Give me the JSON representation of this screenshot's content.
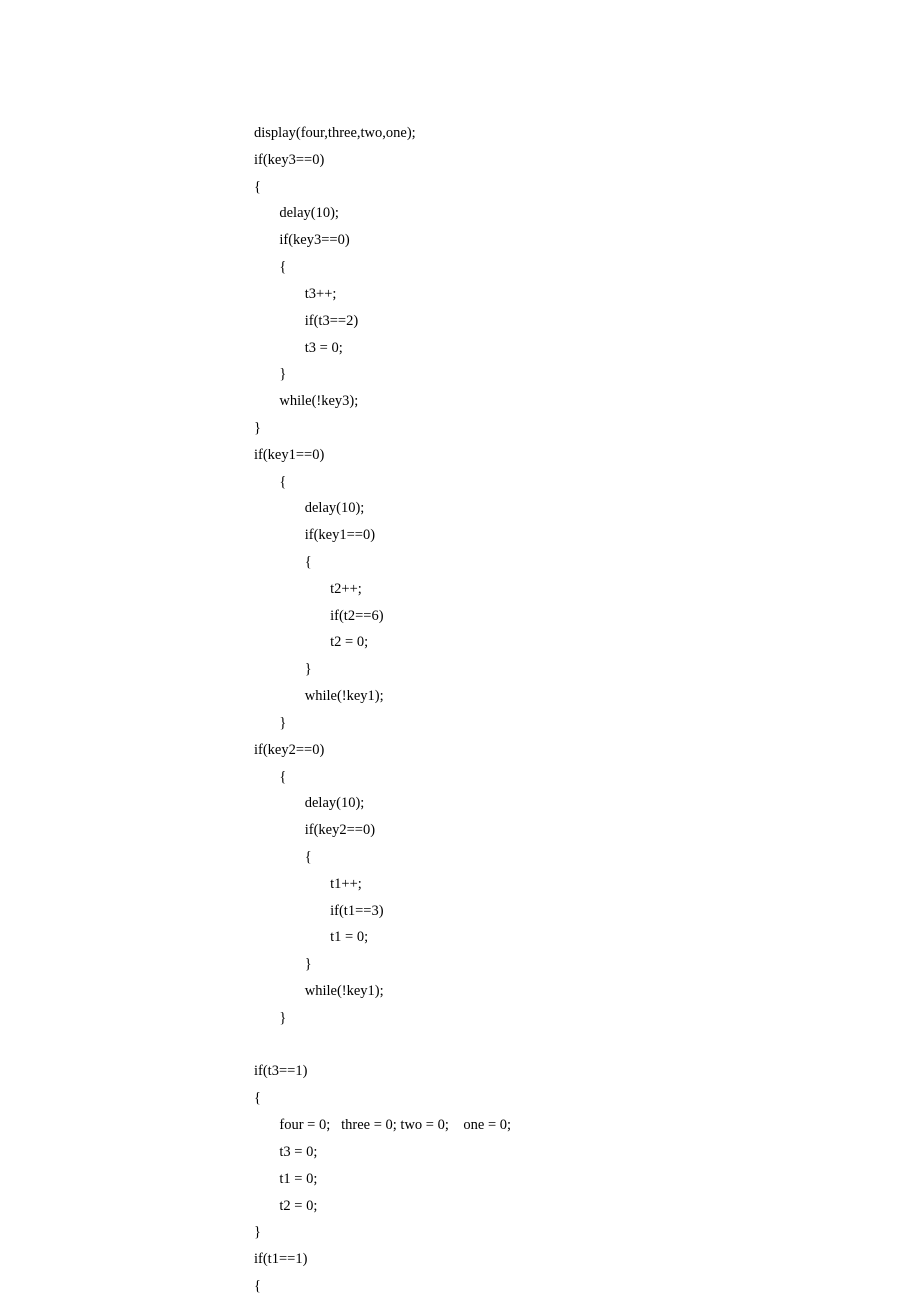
{
  "code": {
    "lines": [
      "display(four,three,two,one);",
      "if(key3==0)",
      "{",
      "       delay(10);",
      "       if(key3==0)",
      "       {",
      "              t3++;",
      "              if(t3==2)",
      "              t3 = 0;",
      "       }",
      "       while(!key3);",
      "}",
      "if(key1==0)",
      "       {",
      "              delay(10);",
      "              if(key1==0)",
      "              {",
      "                     t2++;",
      "                     if(t2==6)",
      "                     t2 = 0;",
      "              }",
      "              while(!key1);",
      "       }",
      "if(key2==0)",
      "       {",
      "              delay(10);",
      "              if(key2==0)",
      "              {",
      "                     t1++;",
      "                     if(t1==3)",
      "                     t1 = 0;",
      "              }",
      "              while(!key1);",
      "       }",
      "",
      "if(t3==1)",
      "{",
      "       four = 0;   three = 0; two = 0;    one = 0;",
      "       t3 = 0;",
      "       t1 = 0;",
      "       t2 = 0;",
      "}",
      "if(t1==1)",
      "{"
    ]
  }
}
